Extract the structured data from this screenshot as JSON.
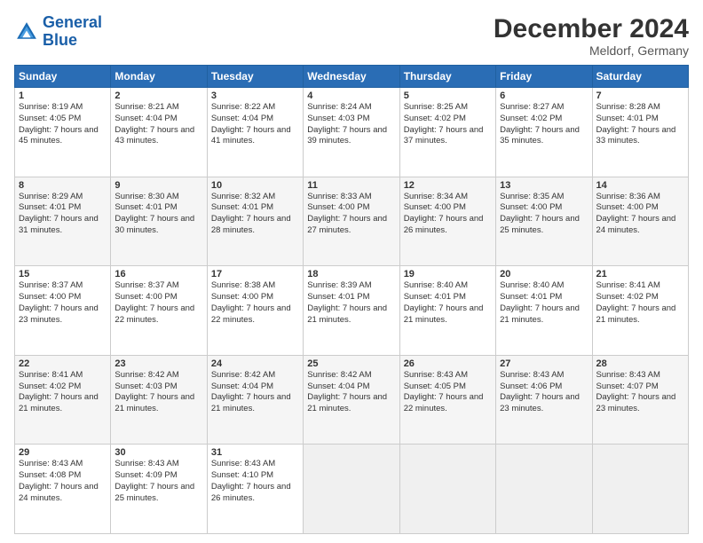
{
  "logo": {
    "text_general": "General",
    "text_blue": "Blue"
  },
  "header": {
    "month": "December 2024",
    "location": "Meldorf, Germany"
  },
  "days": [
    "Sunday",
    "Monday",
    "Tuesday",
    "Wednesday",
    "Thursday",
    "Friday",
    "Saturday"
  ],
  "weeks": [
    [
      {
        "day": "1",
        "sunrise": "8:19 AM",
        "sunset": "4:05 PM",
        "daylight": "7 hours and 45 minutes."
      },
      {
        "day": "2",
        "sunrise": "8:21 AM",
        "sunset": "4:04 PM",
        "daylight": "7 hours and 43 minutes."
      },
      {
        "day": "3",
        "sunrise": "8:22 AM",
        "sunset": "4:04 PM",
        "daylight": "7 hours and 41 minutes."
      },
      {
        "day": "4",
        "sunrise": "8:24 AM",
        "sunset": "4:03 PM",
        "daylight": "7 hours and 39 minutes."
      },
      {
        "day": "5",
        "sunrise": "8:25 AM",
        "sunset": "4:02 PM",
        "daylight": "7 hours and 37 minutes."
      },
      {
        "day": "6",
        "sunrise": "8:27 AM",
        "sunset": "4:02 PM",
        "daylight": "7 hours and 35 minutes."
      },
      {
        "day": "7",
        "sunrise": "8:28 AM",
        "sunset": "4:01 PM",
        "daylight": "7 hours and 33 minutes."
      }
    ],
    [
      {
        "day": "8",
        "sunrise": "8:29 AM",
        "sunset": "4:01 PM",
        "daylight": "7 hours and 31 minutes."
      },
      {
        "day": "9",
        "sunrise": "8:30 AM",
        "sunset": "4:01 PM",
        "daylight": "7 hours and 30 minutes."
      },
      {
        "day": "10",
        "sunrise": "8:32 AM",
        "sunset": "4:01 PM",
        "daylight": "7 hours and 28 minutes."
      },
      {
        "day": "11",
        "sunrise": "8:33 AM",
        "sunset": "4:00 PM",
        "daylight": "7 hours and 27 minutes."
      },
      {
        "day": "12",
        "sunrise": "8:34 AM",
        "sunset": "4:00 PM",
        "daylight": "7 hours and 26 minutes."
      },
      {
        "day": "13",
        "sunrise": "8:35 AM",
        "sunset": "4:00 PM",
        "daylight": "7 hours and 25 minutes."
      },
      {
        "day": "14",
        "sunrise": "8:36 AM",
        "sunset": "4:00 PM",
        "daylight": "7 hours and 24 minutes."
      }
    ],
    [
      {
        "day": "15",
        "sunrise": "8:37 AM",
        "sunset": "4:00 PM",
        "daylight": "7 hours and 23 minutes."
      },
      {
        "day": "16",
        "sunrise": "8:37 AM",
        "sunset": "4:00 PM",
        "daylight": "7 hours and 22 minutes."
      },
      {
        "day": "17",
        "sunrise": "8:38 AM",
        "sunset": "4:00 PM",
        "daylight": "7 hours and 22 minutes."
      },
      {
        "day": "18",
        "sunrise": "8:39 AM",
        "sunset": "4:01 PM",
        "daylight": "7 hours and 21 minutes."
      },
      {
        "day": "19",
        "sunrise": "8:40 AM",
        "sunset": "4:01 PM",
        "daylight": "7 hours and 21 minutes."
      },
      {
        "day": "20",
        "sunrise": "8:40 AM",
        "sunset": "4:01 PM",
        "daylight": "7 hours and 21 minutes."
      },
      {
        "day": "21",
        "sunrise": "8:41 AM",
        "sunset": "4:02 PM",
        "daylight": "7 hours and 21 minutes."
      }
    ],
    [
      {
        "day": "22",
        "sunrise": "8:41 AM",
        "sunset": "4:02 PM",
        "daylight": "7 hours and 21 minutes."
      },
      {
        "day": "23",
        "sunrise": "8:42 AM",
        "sunset": "4:03 PM",
        "daylight": "7 hours and 21 minutes."
      },
      {
        "day": "24",
        "sunrise": "8:42 AM",
        "sunset": "4:04 PM",
        "daylight": "7 hours and 21 minutes."
      },
      {
        "day": "25",
        "sunrise": "8:42 AM",
        "sunset": "4:04 PM",
        "daylight": "7 hours and 21 minutes."
      },
      {
        "day": "26",
        "sunrise": "8:43 AM",
        "sunset": "4:05 PM",
        "daylight": "7 hours and 22 minutes."
      },
      {
        "day": "27",
        "sunrise": "8:43 AM",
        "sunset": "4:06 PM",
        "daylight": "7 hours and 23 minutes."
      },
      {
        "day": "28",
        "sunrise": "8:43 AM",
        "sunset": "4:07 PM",
        "daylight": "7 hours and 23 minutes."
      }
    ],
    [
      {
        "day": "29",
        "sunrise": "8:43 AM",
        "sunset": "4:08 PM",
        "daylight": "7 hours and 24 minutes."
      },
      {
        "day": "30",
        "sunrise": "8:43 AM",
        "sunset": "4:09 PM",
        "daylight": "7 hours and 25 minutes."
      },
      {
        "day": "31",
        "sunrise": "8:43 AM",
        "sunset": "4:10 PM",
        "daylight": "7 hours and 26 minutes."
      },
      null,
      null,
      null,
      null
    ]
  ],
  "labels": {
    "sunrise": "Sunrise:",
    "sunset": "Sunset:",
    "daylight": "Daylight:"
  }
}
